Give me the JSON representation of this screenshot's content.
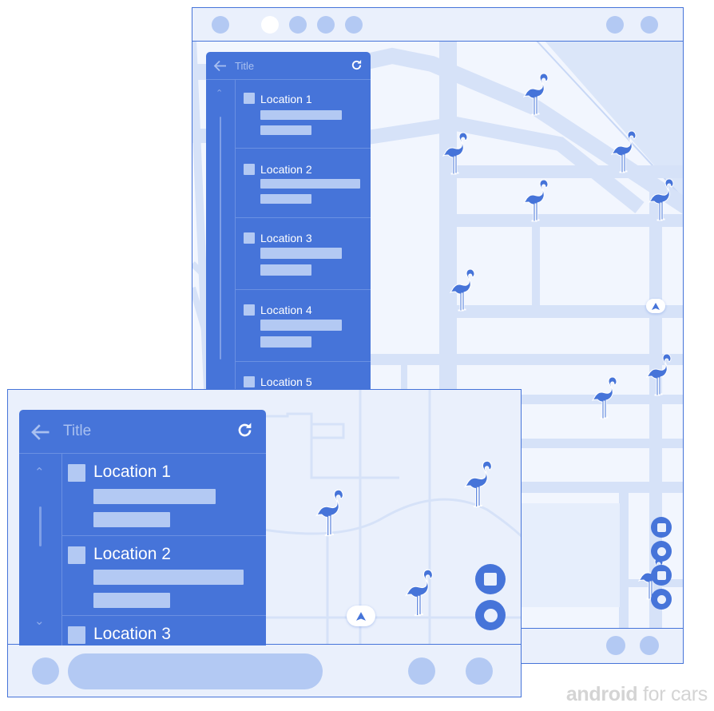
{
  "colors": {
    "accent": "#4674d9",
    "map_background": "#eaf0fc",
    "road": "#d6e2f8",
    "placeholder": "#b3c9f3",
    "brand_text": "#d4d4d4"
  },
  "brand": {
    "bold": "android",
    "regular": " for cars"
  },
  "portrait_screen": {
    "top_bar": {
      "left_dots": [
        "dot",
        "dot-active",
        "dot",
        "dot",
        "dot"
      ],
      "right_dots": [
        "dot",
        "dot"
      ]
    },
    "panel": {
      "back_icon": "arrow-back-icon",
      "title": "Title",
      "refresh_icon": "refresh-icon",
      "scroll_up_icon": "chevron-up-icon",
      "items": [
        {
          "label": "Location 1",
          "icon": "placeholder-square-icon"
        },
        {
          "label": "Location 2",
          "icon": "placeholder-square-icon"
        },
        {
          "label": "Location 3",
          "icon": "placeholder-square-icon"
        },
        {
          "label": "Location 4",
          "icon": "placeholder-square-icon"
        },
        {
          "label": "Location 5",
          "icon": "placeholder-square-icon"
        }
      ]
    },
    "map": {
      "markers": [
        "flamingo-icon",
        "flamingo-icon",
        "flamingo-icon",
        "flamingo-icon",
        "flamingo-icon",
        "flamingo-icon",
        "flamingo-icon",
        "flamingo-icon",
        "flamingo-icon",
        "flamingo-icon"
      ],
      "current_location_icon": "navigation-arrow-icon",
      "map_actions": [
        "stop-icon",
        "record-icon",
        "stop-icon",
        "record-icon"
      ]
    },
    "bottom_bar": {
      "right_dots": [
        "dot",
        "dot"
      ]
    }
  },
  "landscape_screen": {
    "panel": {
      "back_icon": "arrow-back-icon",
      "title": "Title",
      "refresh_icon": "refresh-icon",
      "scroll_up_icon": "chevron-up-icon",
      "scroll_down_icon": "chevron-down-icon",
      "items": [
        {
          "label": "Location 1",
          "icon": "placeholder-square-icon"
        },
        {
          "label": "Location 2",
          "icon": "placeholder-square-icon"
        },
        {
          "label": "Location 3",
          "icon": "placeholder-square-icon"
        }
      ]
    },
    "map": {
      "markers": [
        "flamingo-icon",
        "flamingo-icon",
        "flamingo-icon"
      ],
      "current_location_icon": "navigation-arrow-icon",
      "map_actions": [
        "stop-icon",
        "record-icon"
      ]
    },
    "bottom_bar": {
      "left_dot": "dot",
      "search_pill": "pill",
      "right_dots": [
        "dot",
        "dot"
      ]
    }
  }
}
